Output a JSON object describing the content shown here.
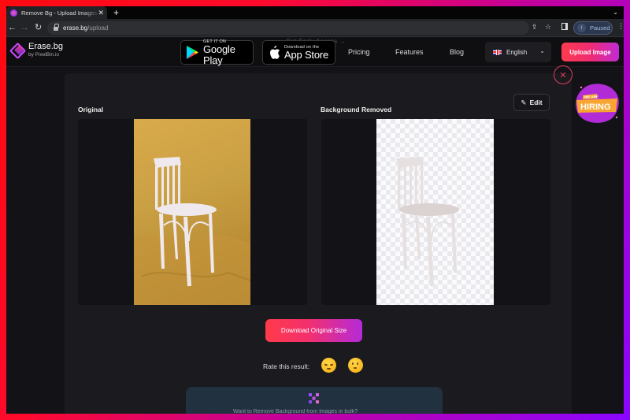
{
  "browser": {
    "tab_title": "Remove Bg - Upload Images to Remove Background",
    "new_tab_label": "+",
    "url_host": "erase.bg",
    "url_path": "/upload",
    "profile_initial": "I",
    "profile_status": "Paused",
    "icons": [
      "back-arrow-icon",
      "forward-arrow-icon",
      "reload-icon",
      "lock-icon",
      "share-icon",
      "star-icon",
      "side-panel-icon",
      "kebab-menu-icon"
    ]
  },
  "header": {
    "logo_name": "Erase.bg",
    "logo_sub": "by PixelBin.io",
    "google_play_small": "GET IT ON",
    "google_play_big": "Google Play",
    "app_store_small": "Download on the",
    "app_store_big": "App Store",
    "ghost_text": "Get Early Access →",
    "nav": [
      "Pricing",
      "Features",
      "Blog"
    ],
    "language": "English",
    "upload_label": "Upload Image"
  },
  "hiring_badge": {
    "small_text": "WE ARE",
    "big_text": "HIRING",
    "colors": {
      "blob": "#b12bd6",
      "banner": "#f9a531"
    }
  },
  "result": {
    "original_title": "Original",
    "removed_title": "Background Removed",
    "edit_label": "Edit",
    "download_label": "Download Original Size",
    "rate_label": "Rate this result:",
    "rating_options": [
      "sad-face-emoji",
      "neutral-face-emoji"
    ]
  },
  "promo": {
    "text": "Want to Remove Background from Images in bulk?"
  },
  "colors": {
    "accent_start": "#ff3a4a",
    "accent_end": "#b52ad9",
    "close_ring": "#e03b5c",
    "page_bg": "#131317",
    "card_bg": "#1b1b1f"
  }
}
